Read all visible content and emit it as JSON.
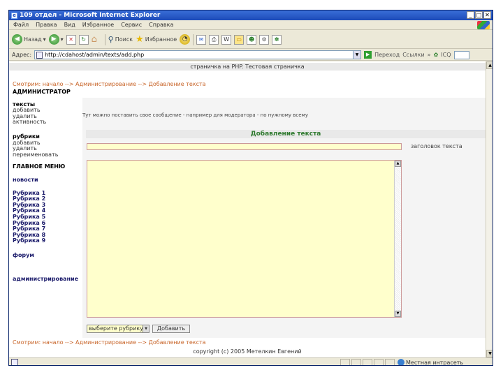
{
  "window": {
    "title": "109 отдел - Microsoft Internet Explorer",
    "controls": {
      "minimize": "_",
      "maximize": "□",
      "close": "✕"
    }
  },
  "menubar": [
    "Файл",
    "Правка",
    "Вид",
    "Избранное",
    "Сервис",
    "Справка"
  ],
  "toolbar": {
    "back": "Назад",
    "search": "Поиск",
    "favorites": "Избранное"
  },
  "address": {
    "label": "Адрес:",
    "url": "http://cdahost/admin/texts/add.php",
    "go": "Переход",
    "links": "Ссылки",
    "links_chevron": "»",
    "extra": "ICQ"
  },
  "page": {
    "header": "страничка на PHP. Тестовая страничка",
    "breadcrumb": "Смотрим: начало --> Администрирование --> Добавление текста",
    "notice": "Тут можно поставить свое сообщение - например для модератора - по нужному всему",
    "copyright": "copyright (c) 2005 Метелкин Евгений"
  },
  "sidebar": {
    "admin_header": "АДМИНИСТРАТОР",
    "texts": "тексты",
    "texts_items": [
      "добавить",
      "удалить",
      "активность"
    ],
    "rubrics": "рубрики",
    "rubrics_items": [
      "добавить",
      "удалить",
      "переименовать"
    ],
    "main_menu": "ГЛАВНОЕ МЕНЮ",
    "news": "новости",
    "rubric_list": [
      "Рубрика 1",
      "Рубрика 2",
      "Рубрика 3",
      "Рубрика 4",
      "Рубрика 5",
      "Рубрика 6",
      "Рубрика 7",
      "Рубрика 8",
      "Рубрика 9"
    ],
    "forum": "форум",
    "admin_link": "администрирование"
  },
  "form": {
    "title": "Добавление текста",
    "title_label": "заголовок текста",
    "title_value": "",
    "body_value": "",
    "rubric_select": "выберите рубрику",
    "submit": "Добавить"
  },
  "status": {
    "zone": "Местная интрасеть"
  },
  "colors": {
    "breadcrumb": "#c86428",
    "form_title": "#2f7a2f",
    "input_bg": "#ffffcc",
    "titlebar": "#1c4ab8"
  }
}
